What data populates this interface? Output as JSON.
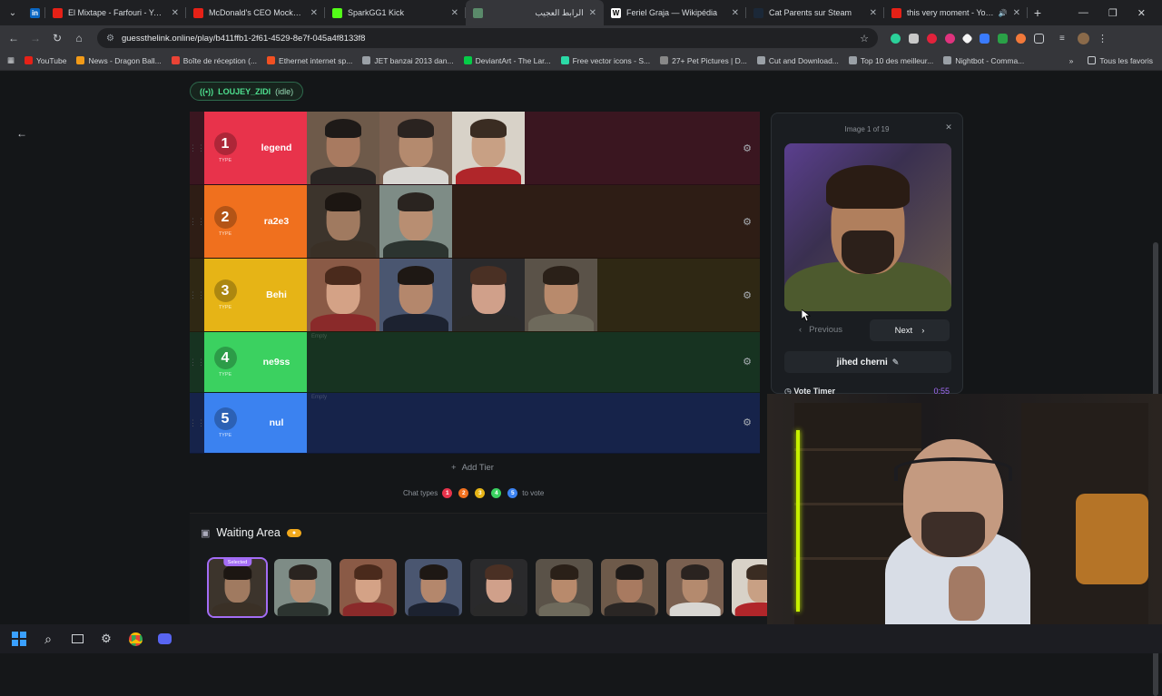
{
  "browser": {
    "tabs": [
      {
        "title": "El Mixtape - Farfouri - YouTube",
        "favicon_color": "#e62117",
        "favicon_glyph": ""
      },
      {
        "title": "McDonald's CEO Mocked for",
        "favicon_color": "#e62117",
        "favicon_glyph": ""
      },
      {
        "title": "SparkGG1 Kick",
        "favicon_color": "#53fc18",
        "favicon_glyph": ""
      },
      {
        "title": "الرابط العجيب",
        "favicon_color": "#5a8a6a",
        "favicon_glyph": ""
      },
      {
        "title": "Feriel Graja — Wikipédia",
        "favicon_color": "#ffffff",
        "favicon_glyph": "W"
      },
      {
        "title": "Cat Parents sur Steam",
        "favicon_color": "#1b2838",
        "favicon_glyph": ""
      },
      {
        "title": "this very moment - YouTu",
        "favicon_color": "#e62117",
        "favicon_glyph": ""
      }
    ],
    "url": "guessthelink.online/play/b411ffb1-2f61-4529-8e7f-045a4f8133f8",
    "bookmarks": [
      {
        "label": "YouTube",
        "color": "#e62117"
      },
      {
        "label": "News - Dragon Ball...",
        "color": "#f29b18"
      },
      {
        "label": "Boîte de réception (...",
        "color": "#ea4335"
      },
      {
        "label": "Ethernet internet sp...",
        "color": "#f25022"
      },
      {
        "label": "JET banzai 2013 dan...",
        "color": "#9aa0a6"
      },
      {
        "label": "DeviantArt - The Lar...",
        "color": "#05cc47"
      },
      {
        "label": "Free vector icons - S...",
        "color": "#2bd9a6"
      },
      {
        "label": "27+ Pet Pictures | D...",
        "color": "#888888"
      },
      {
        "label": "Cut and Download...",
        "color": "#9aa0a6"
      },
      {
        "label": "Top 10 des meilleur...",
        "color": "#9aa0a6"
      },
      {
        "label": "Nightbot - Comma...",
        "color": "#9aa0a6"
      }
    ],
    "all_bookmarks_label": "Tous les favoris"
  },
  "app": {
    "user_chip": {
      "name": "LOUJEY_ZIDI",
      "status": "(idle)"
    },
    "tiers": [
      {
        "number": "1",
        "type_label": "TYPE",
        "name": "legend",
        "color": "#e8334b",
        "row_color": "#3a1620",
        "items": 3,
        "empty_label": ""
      },
      {
        "number": "2",
        "type_label": "TYPE",
        "name": "ra2e3",
        "color": "#f0701e",
        "row_color": "#2e1d15",
        "items": 2,
        "empty_label": ""
      },
      {
        "number": "3",
        "type_label": "TYPE",
        "name": "Behi",
        "color": "#e6b416",
        "row_color": "#2f2814",
        "items": 4,
        "empty_label": ""
      },
      {
        "number": "4",
        "type_label": "TYPE",
        "name": "ne9ss",
        "color": "#3bd160",
        "row_color": "#173321",
        "items": 0,
        "empty_label": "Empty"
      },
      {
        "number": "5",
        "type_label": "TYPE",
        "name": "nul",
        "color": "#3b82f0",
        "row_color": "#16234a",
        "items": 0,
        "empty_label": "Empty"
      }
    ],
    "add_tier_label": "Add Tier",
    "chat_types": {
      "prefix": "Chat types",
      "suffix": "to vote",
      "dots": [
        {
          "n": "1",
          "color": "#e8334b"
        },
        {
          "n": "2",
          "color": "#f0701e"
        },
        {
          "n": "3",
          "color": "#e6b416"
        },
        {
          "n": "4",
          "color": "#3bd160"
        },
        {
          "n": "5",
          "color": "#3b82f0"
        }
      ]
    },
    "waiting_area": {
      "title": "Waiting Area",
      "selected_label": "Selected",
      "thumb_count": 9
    },
    "detail_panel": {
      "counter": "Image 1 of 19",
      "previous_label": "Previous",
      "next_label": "Next",
      "person_name": "jihed cherni",
      "vote_timer_label": "Vote Timer",
      "vote_timer_value": "0:55"
    }
  }
}
